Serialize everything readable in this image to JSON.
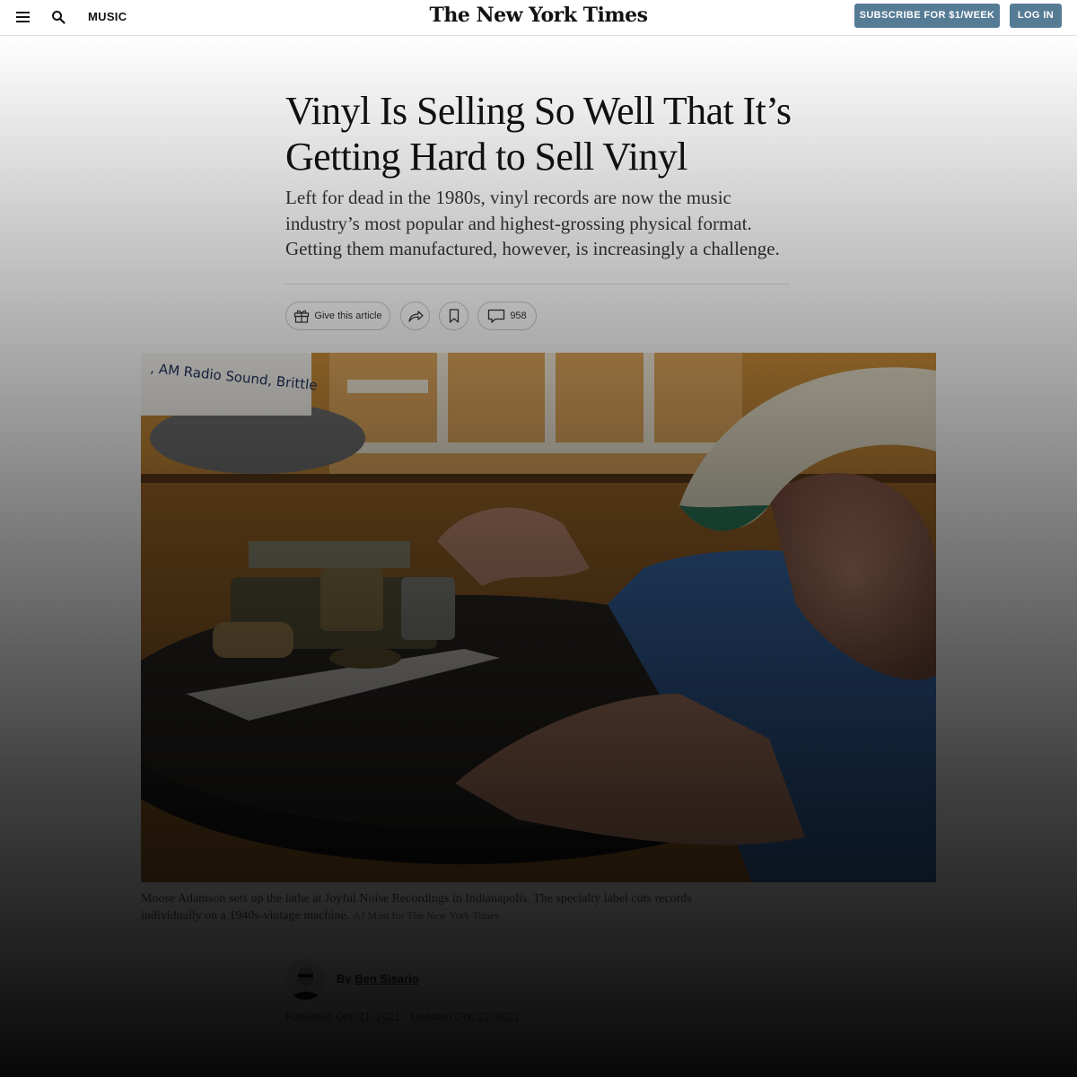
{
  "header": {
    "section": "MUSIC",
    "masthead": "The New York Times",
    "subscribe_label": "SUBSCRIBE FOR $1/WEEK",
    "login_label": "LOG IN",
    "button_color": "#567b95"
  },
  "article": {
    "headline": "Vinyl Is Selling So Well That It’s Getting Hard to Sell Vinyl",
    "summary": "Left for dead in the 1980s, vinyl records are now the music industry’s most popular and highest-grossing physical format. Getting them manufactured, however, is increasingly a challenge.",
    "tools": {
      "gift_label": "Give this article",
      "comment_count": "958",
      "icons": [
        "gift-icon",
        "share-icon",
        "bookmark-icon",
        "comment-icon"
      ]
    },
    "photo": {
      "sign_text": ", AM Radio Sound, Brittle"
    },
    "caption": {
      "text": "Moose Adamson sets up the lathe at Joyful Noise Recordings in Indianapolis. The specialty label cuts records individually on a 1940s-vintage machine.",
      "credit": "AJ Mast for The New York Times"
    },
    "byline": {
      "prefix": "By",
      "author": "Ben Sisario",
      "published": "Published Oct. 21, 2021",
      "updated": "Updated Oct. 22, 2021"
    }
  }
}
